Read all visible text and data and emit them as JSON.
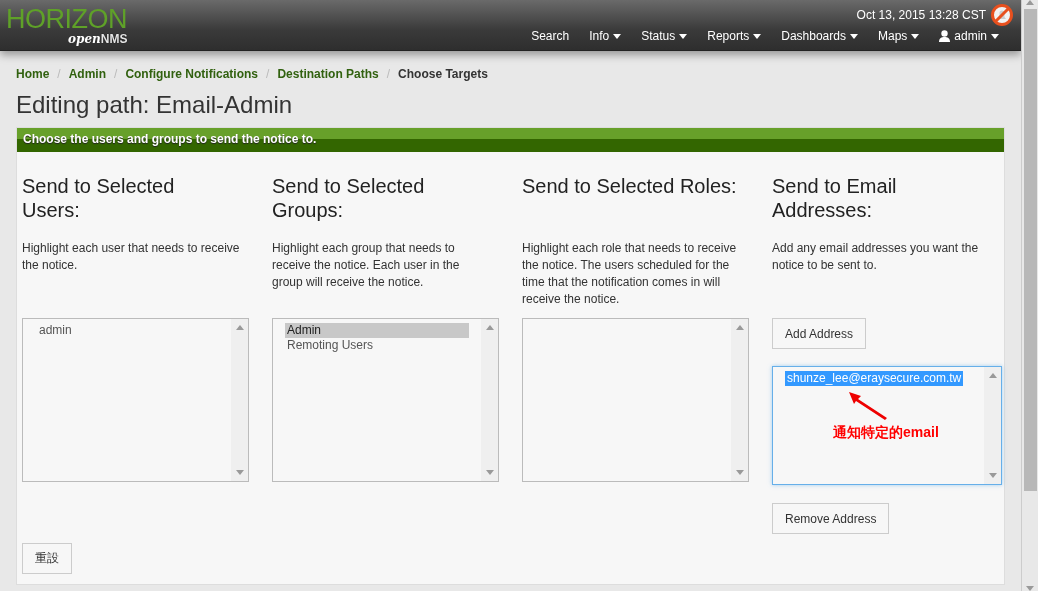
{
  "logo": {
    "main": "HORIZON",
    "sub_light": "open",
    "sub_bold": "NMS"
  },
  "clock": "Oct 13, 2015 13:28 CST",
  "nav": [
    {
      "label": "Search",
      "has_menu": false,
      "kind": "link"
    },
    {
      "label": "Info",
      "has_menu": true,
      "kind": "link"
    },
    {
      "label": "Status",
      "has_menu": true,
      "kind": "link"
    },
    {
      "label": "Reports",
      "has_menu": true,
      "kind": "link"
    },
    {
      "label": "Dashboards",
      "has_menu": true,
      "kind": "link"
    },
    {
      "label": "Maps",
      "has_menu": true,
      "kind": "link"
    },
    {
      "label": "admin",
      "has_menu": true,
      "kind": "user"
    }
  ],
  "breadcrumb": [
    {
      "label": "Home",
      "current": false
    },
    {
      "separator": "/",
      "label": "Admin",
      "current": false
    },
    {
      "separator": "/",
      "label": "Configure Notifications",
      "current": false
    },
    {
      "separator": "/",
      "label": "Destination Paths",
      "current": false
    },
    {
      "separator": "/",
      "label": "Choose Targets",
      "current": true
    }
  ],
  "title": "Editing path: Email-Admin",
  "panel": {
    "header": "Choose the users and groups to send the notice to.",
    "columns": [
      {
        "kind": "list",
        "heading": [
          "Send to Selected",
          "Users:"
        ],
        "description": "Highlight each user that needs to receive the notice.",
        "focused": false,
        "items": [
          {
            "label": "admin",
            "selected": false
          }
        ]
      },
      {
        "kind": "list",
        "heading": [
          "Send to Selected",
          "Groups:"
        ],
        "description": "Highlight each group that needs to receive the notice. Each user in the group will receive the notice.",
        "focused": false,
        "items": [
          {
            "label": "Admin",
            "selected": true
          },
          {
            "label": "Remoting Users",
            "selected": false
          }
        ]
      },
      {
        "kind": "list",
        "heading": [
          "Send to Selected Roles:"
        ],
        "description": "Highlight each role that needs to receive the notice. The users scheduled for the time that the notification comes in will receive the notice.",
        "focused": false
      },
      {
        "kind": "email",
        "heading": [
          "Send to Email",
          "Addresses:"
        ],
        "description": "Add any email addresses you want the notice to be sent to.",
        "add_button": "Add Address",
        "remove_button": "Remove Address",
        "focused": true,
        "items": [
          {
            "label": "shunze_lee@eraysecure.com.tw",
            "selected": true
          }
        ],
        "annotation": "通知特定的email"
      }
    ],
    "reset_button": "重設"
  }
}
